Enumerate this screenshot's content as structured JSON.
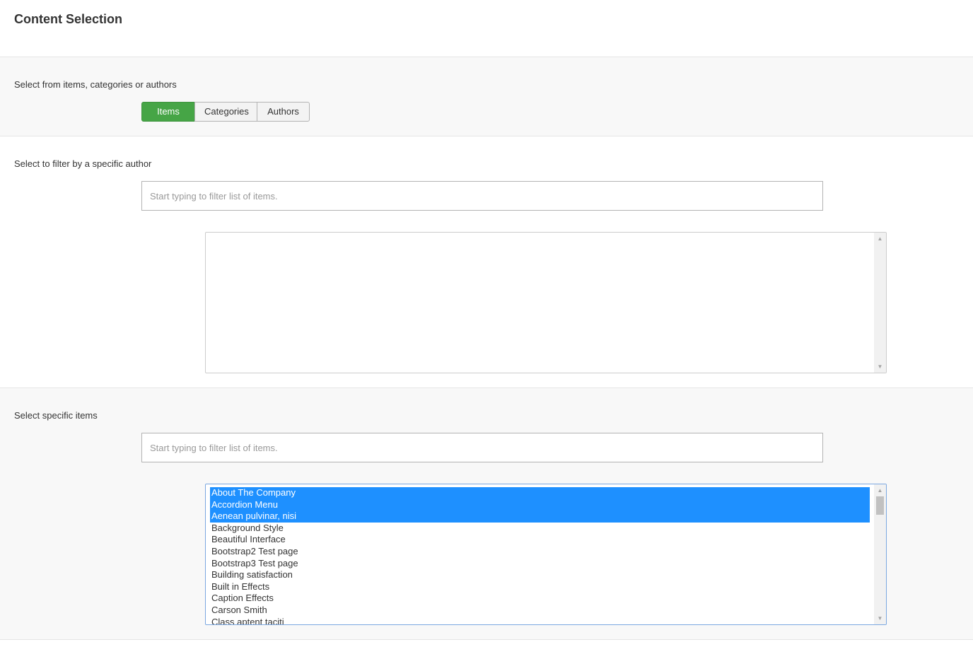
{
  "page": {
    "title": "Content Selection"
  },
  "type_section": {
    "label": "Select from items, categories or authors",
    "buttons": [
      {
        "label": "Items",
        "active": true
      },
      {
        "label": "Categories",
        "active": false
      },
      {
        "label": "Authors",
        "active": false
      }
    ]
  },
  "author_section": {
    "label": "Select to filter by a specific author",
    "filter_placeholder": "Start typing to filter list of items.",
    "filter_value": ""
  },
  "items_section": {
    "label": "Select specific items",
    "filter_placeholder": "Start typing to filter list of items.",
    "filter_value": "",
    "items": [
      {
        "label": "About The Company",
        "selected": true
      },
      {
        "label": "Accordion Menu",
        "selected": true
      },
      {
        "label": "Aenean pulvinar, nisi",
        "selected": true
      },
      {
        "label": "Background Style",
        "selected": false
      },
      {
        "label": "Beautiful Interface",
        "selected": false
      },
      {
        "label": "Bootstrap2 Test page",
        "selected": false
      },
      {
        "label": "Bootstrap3 Test page",
        "selected": false
      },
      {
        "label": "Building satisfaction",
        "selected": false
      },
      {
        "label": "Built in Effects",
        "selected": false
      },
      {
        "label": "Caption Effects",
        "selected": false
      },
      {
        "label": "Carson Smith",
        "selected": false
      },
      {
        "label": "Class aptent taciti",
        "selected": false
      }
    ]
  },
  "colors": {
    "accent_green": "#46a546",
    "selection_blue": "#1e90ff"
  },
  "icons": {
    "scroll_up": "triangle-up-icon",
    "scroll_down": "triangle-down-icon"
  }
}
